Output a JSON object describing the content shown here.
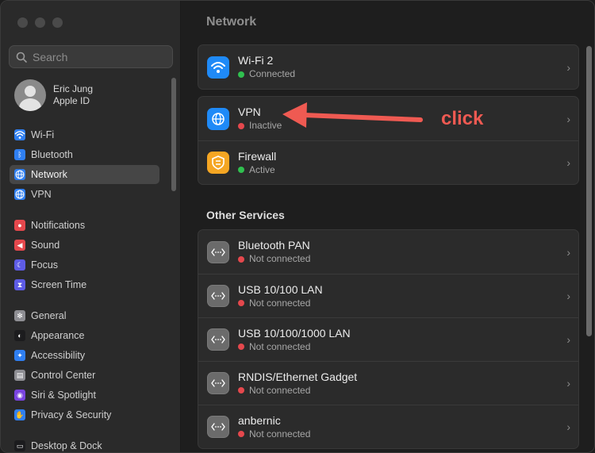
{
  "window": {
    "title": "Network"
  },
  "sidebar": {
    "search_placeholder": "Search",
    "account": {
      "name": "Eric Jung",
      "subtitle": "Apple ID"
    },
    "items": [
      {
        "label": "Wi-Fi",
        "icon": "wifi-icon",
        "color": "#2f7ff2"
      },
      {
        "label": "Bluetooth",
        "icon": "bluetooth-icon",
        "color": "#2f7ff2"
      },
      {
        "label": "Network",
        "icon": "globe-icon",
        "color": "#2f7ff2",
        "active": true
      },
      {
        "label": "VPN",
        "icon": "vpn-icon",
        "color": "#2f7ff2"
      },
      {
        "label": "Notifications",
        "icon": "bell-icon",
        "color": "#e5484d"
      },
      {
        "label": "Sound",
        "icon": "speaker-icon",
        "color": "#e5484d"
      },
      {
        "label": "Focus",
        "icon": "moon-icon",
        "color": "#5e5ce6"
      },
      {
        "label": "Screen Time",
        "icon": "hourglass-icon",
        "color": "#5e5ce6"
      },
      {
        "label": "General",
        "icon": "gear-icon",
        "color": "#8e8e93"
      },
      {
        "label": "Appearance",
        "icon": "appearance-icon",
        "color": "#1c1c1e"
      },
      {
        "label": "Accessibility",
        "icon": "accessibility-icon",
        "color": "#2f7ff2"
      },
      {
        "label": "Control Center",
        "icon": "control-center-icon",
        "color": "#8e8e93"
      },
      {
        "label": "Siri & Spotlight",
        "icon": "siri-icon",
        "color": "#7a44e0"
      },
      {
        "label": "Privacy & Security",
        "icon": "hand-icon",
        "color": "#2f7ff2"
      },
      {
        "label": "Desktop & Dock",
        "icon": "dock-icon",
        "color": "#1c1c1e"
      }
    ]
  },
  "main": {
    "title": "Network",
    "primary_services": [
      {
        "name": "Wi-Fi 2",
        "status": "Connected",
        "status_color": "#30c04f",
        "icon": "wifi-icon",
        "icon_color": "#1f8af7"
      }
    ],
    "security_services": [
      {
        "name": "VPN",
        "status": "Inactive",
        "status_color": "#e5484d",
        "icon": "vpn-globe-icon",
        "icon_color": "#1f8af7"
      },
      {
        "name": "Firewall",
        "status": "Active",
        "status_color": "#30c04f",
        "icon": "firewall-icon",
        "icon_color": "#f5a623"
      }
    ],
    "other_services_title": "Other Services",
    "other_services": [
      {
        "name": "Bluetooth PAN",
        "status": "Not connected",
        "status_color": "#e5484d",
        "icon": "ethernet-icon"
      },
      {
        "name": "USB 10/100 LAN",
        "status": "Not connected",
        "status_color": "#e5484d",
        "icon": "ethernet-icon"
      },
      {
        "name": "USB 10/100/1000 LAN",
        "status": "Not connected",
        "status_color": "#e5484d",
        "icon": "ethernet-icon"
      },
      {
        "name": "RNDIS/Ethernet Gadget",
        "status": "Not connected",
        "status_color": "#e5484d",
        "icon": "ethernet-icon"
      },
      {
        "name": "anbernic",
        "status": "Not connected",
        "status_color": "#e5484d",
        "icon": "ethernet-icon"
      }
    ]
  },
  "annotation": {
    "label": "click",
    "color": "#ef5a52"
  }
}
